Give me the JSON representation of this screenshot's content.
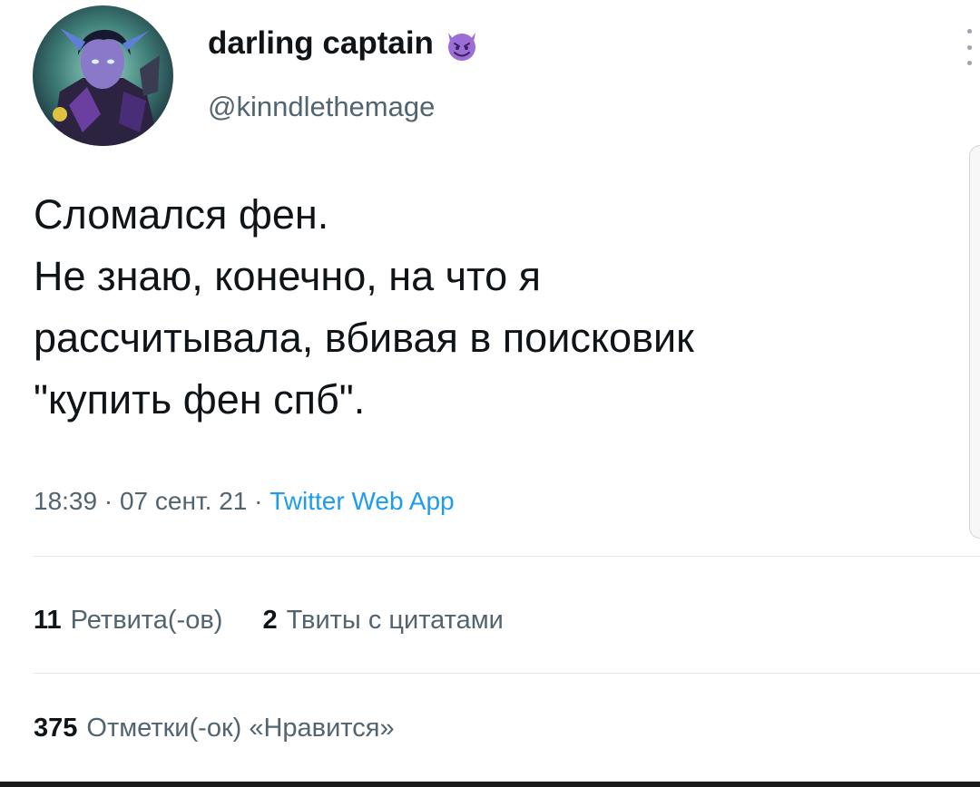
{
  "author": {
    "display_name": "darling captain",
    "handle": "@kinndlethemage",
    "emoji_icon": "smiling-face-with-horns-icon",
    "avatar_icon": "fantasy-character-avatar"
  },
  "tweet": {
    "lines": [
      "Сломался фен.",
      "Не знаю, конечно, на что я",
      "рассчитывала, вбивая в поисковик",
      "\"купить фен спб\"."
    ],
    "time": "18:39",
    "date": "07 сент. 21",
    "source": "Twitter Web App",
    "separator": "·"
  },
  "stats": {
    "retweets_count": "11",
    "retweets_label": "Ретвита(-ов)",
    "quotes_count": "2",
    "quotes_label": "Твиты с цитатами",
    "likes_count": "375",
    "likes_label": "Отметки(-ок) «Нравится»"
  },
  "colors": {
    "text_primary": "#0f1419",
    "text_secondary": "#536471",
    "link": "#1d9bf0",
    "emoji_purple": "#9b6dd6"
  }
}
